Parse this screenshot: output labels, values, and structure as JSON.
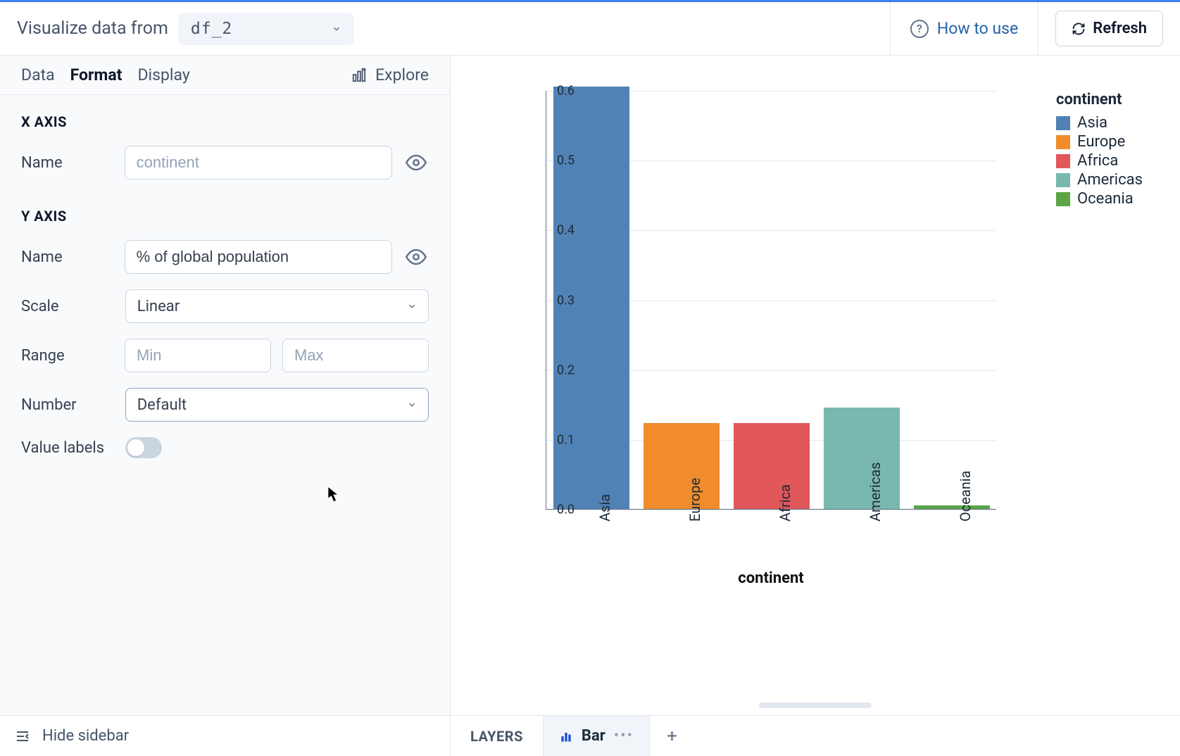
{
  "header": {
    "label": "Visualize data from",
    "dataframe": "df_2",
    "how_to_use": "How to use",
    "refresh": "Refresh"
  },
  "tabs": {
    "data": "Data",
    "format": "Format",
    "display": "Display",
    "explore": "Explore"
  },
  "xaxis": {
    "title": "X AXIS",
    "name_label": "Name",
    "name_placeholder": "continent",
    "name_value": ""
  },
  "yaxis": {
    "title": "Y AXIS",
    "name_label": "Name",
    "name_value": "% of global population",
    "scale_label": "Scale",
    "scale_value": "Linear",
    "range_label": "Range",
    "min_placeholder": "Min",
    "max_placeholder": "Max",
    "number_label": "Number",
    "number_value": "Default",
    "value_labels_label": "Value labels"
  },
  "chart_data": {
    "type": "bar",
    "categories": [
      "Asia",
      "Europe",
      "Africa",
      "Americas",
      "Oceania"
    ],
    "values": [
      0.605,
      0.123,
      0.123,
      0.145,
      0.005
    ],
    "colors": [
      "#5182b5",
      "#f08c2b",
      "#e1575a",
      "#79b8ae",
      "#5ba545"
    ],
    "xlabel": "continent",
    "ylabel": "% of global population",
    "ylim": [
      0.0,
      0.6
    ],
    "yticks": [
      0.0,
      0.1,
      0.2,
      0.3,
      0.4,
      0.5,
      0.6
    ],
    "legend_title": "continent",
    "legend_items": [
      {
        "label": "Asia",
        "color": "#5182b5"
      },
      {
        "label": "Europe",
        "color": "#f08c2b"
      },
      {
        "label": "Africa",
        "color": "#e1575a"
      },
      {
        "label": "Americas",
        "color": "#79b8ae"
      },
      {
        "label": "Oceania",
        "color": "#5ba545"
      }
    ]
  },
  "footer": {
    "hide_sidebar": "Hide sidebar",
    "layers_label": "LAYERS",
    "layer_name": "Bar"
  }
}
